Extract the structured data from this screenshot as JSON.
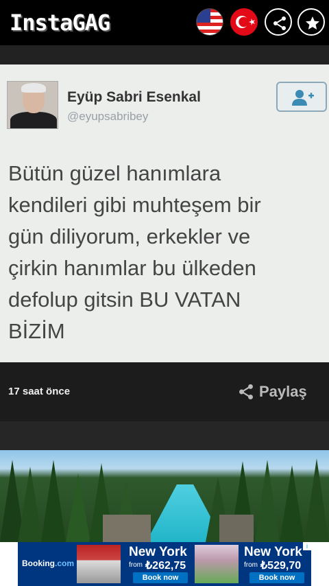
{
  "app": {
    "title": "InstaGAG"
  },
  "header": {
    "icons": [
      "us-flag-icon",
      "turkey-flag-icon",
      "share-icon",
      "star-icon"
    ]
  },
  "post": {
    "author_name": "Eyüp Sabri Esenkal",
    "author_handle": "@eyupsabribey",
    "text": "Bütün güzel hanımlara\nkendileri gibi muhteşem bir\ngün diliyorum, erkekler ve\nçirkin hanımlar bu ülkeden\ndefolup gitsin BU VATAN\nBİZİM",
    "time": "17 saat önce",
    "share_label": "Paylaş"
  },
  "ad": {
    "brand": "Booking",
    "brand_suffix": ".com",
    "offers": [
      {
        "city": "New York",
        "from": "from",
        "price": "₺262,75",
        "cta": "Book now"
      },
      {
        "city": "New York",
        "from": "from",
        "price": "₺529,70",
        "cta": "Book now"
      }
    ],
    "info": "i"
  },
  "colors": {
    "background": "#000000",
    "tweet_bg": "#eceeec",
    "ad_blue": "#003580",
    "ad_button": "#0071c2"
  }
}
